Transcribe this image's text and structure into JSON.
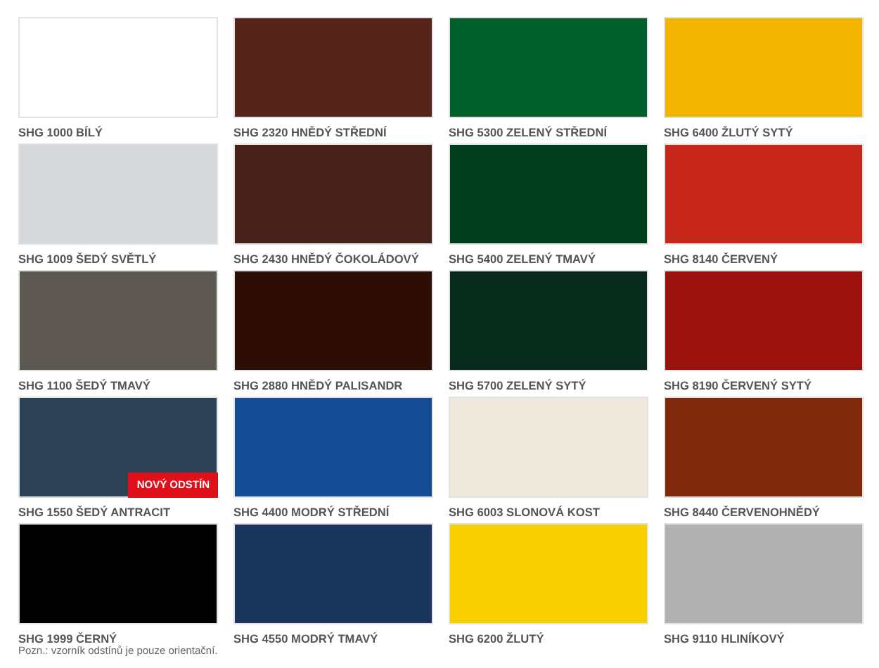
{
  "swatches": [
    {
      "label": "SHG 1000 BÍLÝ",
      "color": "#ffffff"
    },
    {
      "label": "SHG 2320 HNĚDÝ STŘEDNÍ",
      "color": "#55241a"
    },
    {
      "label": "SHG 5300 ZELENÝ STŘEDNÍ",
      "color": "#005f2d"
    },
    {
      "label": "SHG 6400 ŽLUTÝ SYTÝ",
      "color": "#f2b600"
    },
    {
      "label": "SHG 1009 ŠEDÝ SVĚTLÝ",
      "color": "#d6d9dc"
    },
    {
      "label": "SHG 2430 HNĚDÝ ČOKOLÁDOVÝ",
      "color": "#462119"
    },
    {
      "label": "SHG 5400 ZELENÝ TMAVÝ",
      "color": "#003d1c"
    },
    {
      "label": "SHG 8140 ČERVENÝ",
      "color": "#c7271a"
    },
    {
      "label": "SHG 1100 ŠEDÝ TMAVÝ",
      "color": "#5e5853"
    },
    {
      "label": "SHG 2880 HNĚDÝ PALISANDR",
      "color": "#2e0d06"
    },
    {
      "label": "SHG 5700 ZELENÝ SYTÝ",
      "color": "#062a1c"
    },
    {
      "label": "SHG 8190 ČERVENÝ SYTÝ",
      "color": "#9c130e"
    },
    {
      "label": "SHG 1550 ŠEDÝ ANTRACIT",
      "color": "#2e4256",
      "badge": "NOVÝ ODSTÍN"
    },
    {
      "label": "SHG 4400 MODRÝ STŘEDNÍ",
      "color": "#154c94"
    },
    {
      "label": "SHG 6003 SLONOVÁ KOST",
      "color": "#efe8dc"
    },
    {
      "label": "SHG 8440 ČERVENOHNĚDÝ",
      "color": "#7f2a0c"
    },
    {
      "label": "SHG 1999 ČERNÝ",
      "color": "#000000"
    },
    {
      "label": "SHG 4550 MODRÝ TMAVÝ",
      "color": "#1b365d"
    },
    {
      "label": "SHG 6200 ŽLUTÝ",
      "color": "#f8d000"
    },
    {
      "label": "SHG 9110 HLINÍKOVÝ",
      "color": "#b1b1b1"
    }
  ],
  "note": "Pozn.: vzorník odstínů je pouze orientační."
}
